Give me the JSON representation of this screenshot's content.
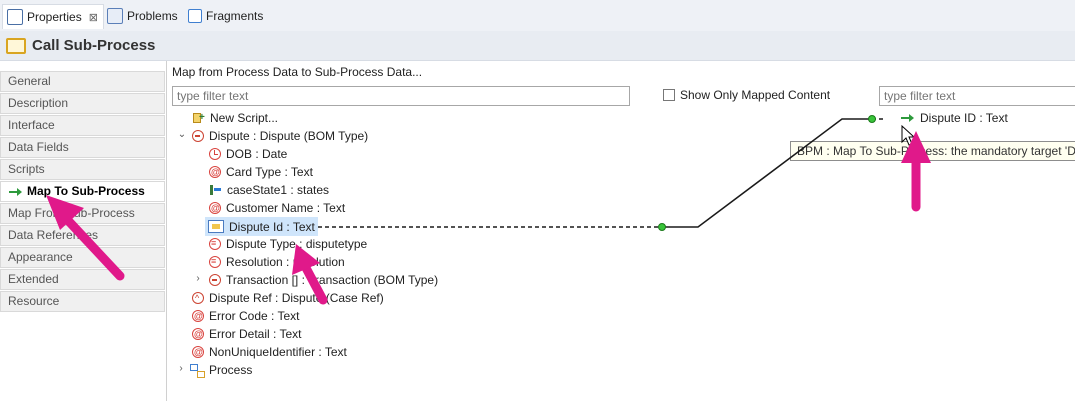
{
  "tabs": [
    {
      "label": "Properties",
      "icon": "properties-icon",
      "active": true,
      "close": "⊠"
    },
    {
      "label": "Problems",
      "icon": "problems-icon",
      "active": false
    },
    {
      "label": "Fragments",
      "icon": "fragments-icon",
      "active": false
    }
  ],
  "title": "Call Sub-Process",
  "sidebar": {
    "items": [
      {
        "label": "General"
      },
      {
        "label": "Description"
      },
      {
        "label": "Interface"
      },
      {
        "label": "Data Fields"
      },
      {
        "label": "Scripts"
      },
      {
        "label": "Map To Sub-Process",
        "selected": true
      },
      {
        "label": "Map From Sub-Process"
      },
      {
        "label": "Data References"
      },
      {
        "label": "Appearance"
      },
      {
        "label": "Extended"
      },
      {
        "label": "Resource"
      }
    ]
  },
  "main": {
    "heading": "Map from Process Data to Sub-Process Data...",
    "left_filter_placeholder": "type filter text",
    "show_only_mapped_label": "Show Only Mapped Content",
    "right_filter_placeholder": "type filter text",
    "tree": [
      {
        "label": "New Script...",
        "icon": "new-script-icon"
      },
      {
        "label": "Dispute : Dispute (BOM Type)",
        "icon": "bom-type-icon",
        "toggle": "⌄"
      },
      {
        "label": "DOB  : Date",
        "icon": "date-icon"
      },
      {
        "label": "Card Type  : Text",
        "icon": "text-attr-icon"
      },
      {
        "label": "caseState1  : states",
        "icon": "states-icon"
      },
      {
        "label": "Customer Name  : Text",
        "icon": "text-attr-icon"
      },
      {
        "label": "Dispute Id  : Text",
        "icon": "field-icon",
        "highlighted": true
      },
      {
        "label": "Dispute Type : disputetype",
        "icon": "enum-icon"
      },
      {
        "label": "Resolution  : resolution",
        "icon": "enum-icon"
      },
      {
        "label": "Transaction [] : Transaction (BOM Type)",
        "icon": "bom-array-icon",
        "toggle": "›"
      },
      {
        "label": "Dispute Ref : Dispute (Case Ref)",
        "icon": "case-ref-icon"
      },
      {
        "label": "Error Code : Text",
        "icon": "text-attr-icon"
      },
      {
        "label": "Error Detail : Text",
        "icon": "text-attr-icon"
      },
      {
        "label": "NonUniqueIdentifier : Text",
        "icon": "text-attr-icon"
      },
      {
        "label": "Process",
        "icon": "process-icon",
        "toggle": "›"
      }
    ],
    "target": {
      "label": "Dispute ID : Text",
      "icon": "map-to-icon"
    },
    "tooltip": "BPM  : Map To Sub-Process: the mandatory target 'Dispute"
  },
  "colors": {
    "annotation_arrow": "#e0198a",
    "connector": "#1a1a1a",
    "connector_dot": "#39c43a",
    "selected_row": "#cfe5fb"
  }
}
